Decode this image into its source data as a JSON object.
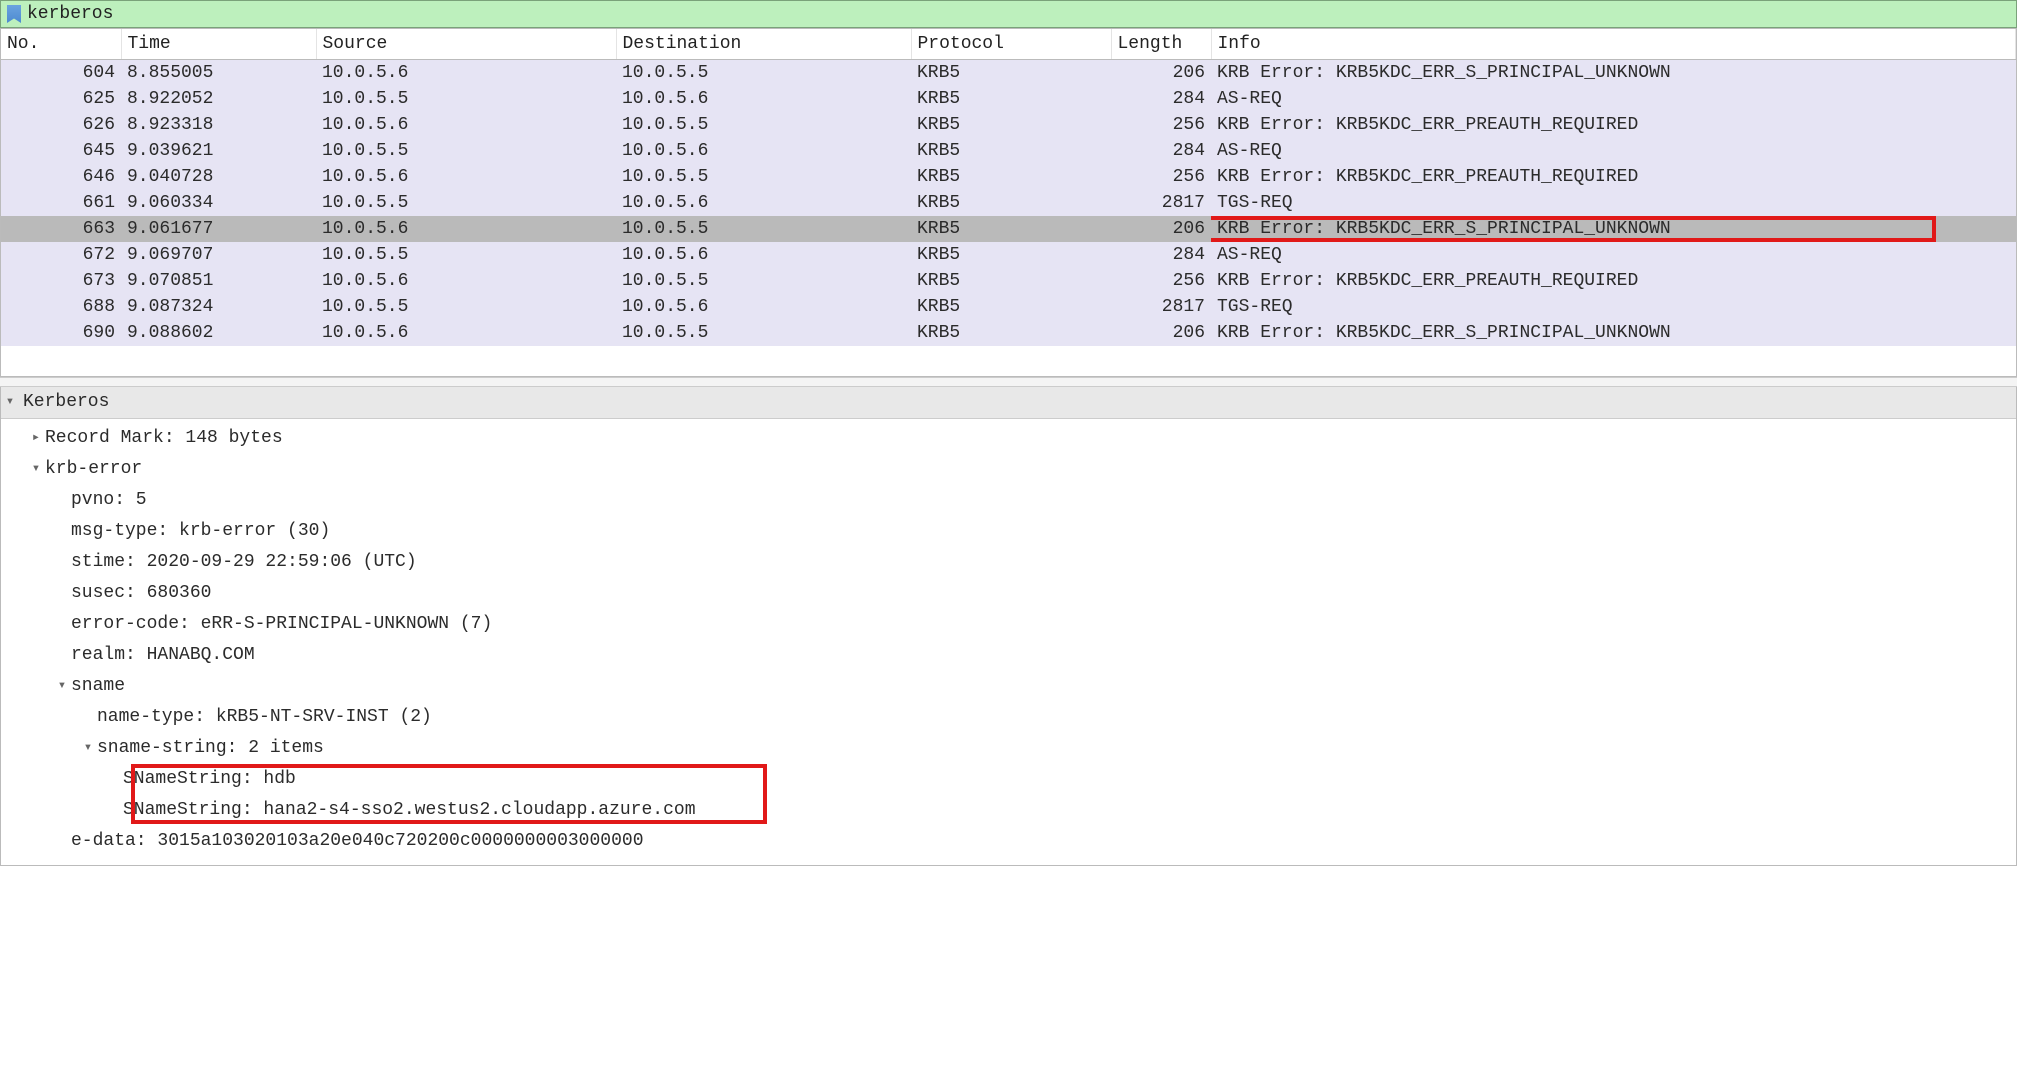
{
  "filter": {
    "text": "kerberos"
  },
  "columns": [
    "No.",
    "Time",
    "Source",
    "Destination",
    "Protocol",
    "Length",
    "Info"
  ],
  "packets": [
    {
      "no": "604",
      "time": "8.855005",
      "src": "10.0.5.6",
      "dst": "10.0.5.5",
      "proto": "KRB5",
      "len": "206",
      "info": "KRB Error: KRB5KDC_ERR_S_PRINCIPAL_UNKNOWN",
      "sel": false,
      "hl": false
    },
    {
      "no": "625",
      "time": "8.922052",
      "src": "10.0.5.5",
      "dst": "10.0.5.6",
      "proto": "KRB5",
      "len": "284",
      "info": "AS-REQ",
      "sel": false,
      "hl": false
    },
    {
      "no": "626",
      "time": "8.923318",
      "src": "10.0.5.6",
      "dst": "10.0.5.5",
      "proto": "KRB5",
      "len": "256",
      "info": "KRB Error: KRB5KDC_ERR_PREAUTH_REQUIRED",
      "sel": false,
      "hl": false
    },
    {
      "no": "645",
      "time": "9.039621",
      "src": "10.0.5.5",
      "dst": "10.0.5.6",
      "proto": "KRB5",
      "len": "284",
      "info": "AS-REQ",
      "sel": false,
      "hl": false
    },
    {
      "no": "646",
      "time": "9.040728",
      "src": "10.0.5.6",
      "dst": "10.0.5.5",
      "proto": "KRB5",
      "len": "256",
      "info": "KRB Error: KRB5KDC_ERR_PREAUTH_REQUIRED",
      "sel": false,
      "hl": false
    },
    {
      "no": "661",
      "time": "9.060334",
      "src": "10.0.5.5",
      "dst": "10.0.5.6",
      "proto": "KRB5",
      "len": "2817",
      "info": "TGS-REQ",
      "sel": false,
      "hl": false
    },
    {
      "no": "663",
      "time": "9.061677",
      "src": "10.0.5.6",
      "dst": "10.0.5.5",
      "proto": "KRB5",
      "len": "206",
      "info": "KRB Error: KRB5KDC_ERR_S_PRINCIPAL_UNKNOWN",
      "sel": true,
      "hl": true
    },
    {
      "no": "672",
      "time": "9.069707",
      "src": "10.0.5.5",
      "dst": "10.0.5.6",
      "proto": "KRB5",
      "len": "284",
      "info": "AS-REQ",
      "sel": false,
      "hl": false
    },
    {
      "no": "673",
      "time": "9.070851",
      "src": "10.0.5.6",
      "dst": "10.0.5.5",
      "proto": "KRB5",
      "len": "256",
      "info": "KRB Error: KRB5KDC_ERR_PREAUTH_REQUIRED",
      "sel": false,
      "hl": false
    },
    {
      "no": "688",
      "time": "9.087324",
      "src": "10.0.5.5",
      "dst": "10.0.5.6",
      "proto": "KRB5",
      "len": "2817",
      "info": "TGS-REQ",
      "sel": false,
      "hl": false
    },
    {
      "no": "690",
      "time": "9.088602",
      "src": "10.0.5.6",
      "dst": "10.0.5.5",
      "proto": "KRB5",
      "len": "206",
      "info": "KRB Error: KRB5KDC_ERR_S_PRINCIPAL_UNKNOWN",
      "sel": false,
      "hl": false
    }
  ],
  "detail": {
    "root": "Kerberos",
    "record_mark": "Record Mark: 148 bytes",
    "krb_error": "krb-error",
    "pvno": "pvno: 5",
    "msg_type": "msg-type: krb-error (30)",
    "stime": "stime: 2020-09-29 22:59:06 (UTC)",
    "susec": "susec: 680360",
    "error_code": "error-code: eRR-S-PRINCIPAL-UNKNOWN (7)",
    "realm": "realm: HANABQ.COM",
    "sname": "sname",
    "name_type": "name-type: kRB5-NT-SRV-INST (2)",
    "sname_string": "sname-string: 2 items",
    "sn0": "SNameString: hdb",
    "sn1": "SNameString: hana2-s4-sso2.westus2.cloudapp.azure.com",
    "e_data": "e-data: 3015a103020103a20e040c720200c0000000003000000"
  },
  "colwidths": {
    "no": 120,
    "time": 195,
    "src": 300,
    "dst": 295,
    "proto": 200,
    "len": 100,
    "info": 800
  }
}
